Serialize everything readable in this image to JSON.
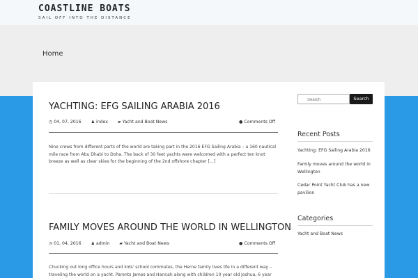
{
  "site": {
    "title": "COASTLINE BOATS",
    "tagline": "SAIL OFF INTO THE DISTANCE"
  },
  "breadcrumb": "Home",
  "posts": [
    {
      "title": "YACHTING: EFG SAILING ARABIA 2016",
      "date": "04, 07, 2016",
      "author": "index",
      "category": "Yacht and Boat News",
      "comments": "Comments Off",
      "excerpt": "Nine crews from different parts of the world are taking part in the 2016 EFG Sailing Arabia – a 160 nautical mile race from Abu Dhabi to Doha. The back of 30 feet yachts were welcomed with a perfect ten knot breeze as well as clear skies for the beginning of the 2nd offshore chapter [...]"
    },
    {
      "title": "FAMILY MOVES AROUND THE WORLD IN WELLINGTON",
      "date": "01, 04, 2016",
      "author": "admin",
      "category": "Yacht and Boat News",
      "comments": "Comments Off",
      "excerpt": "Chucking out long office hours and kids' school commutes, the Herne family lives life in a different way – traveling the world on a yacht. Parents James and Hannah along with children 10 year old Joshua, 6 year old Sadie and 4 year old"
    }
  ],
  "sidebar": {
    "search": {
      "placeholder": "Search",
      "button": "Search"
    },
    "recent_posts": {
      "title": "Recent Posts",
      "items": [
        "Yachting: EFG Sailing Arabia 2016",
        "Family moves around the world in Wellington",
        "Cedar Point Yacht Club has a new pavilion"
      ]
    },
    "categories": {
      "title": "Categories",
      "items": [
        "Yacht and Boat News"
      ]
    }
  },
  "icons": [
    "clock-icon",
    "user-icon",
    "folder-icon",
    "comment-icon",
    "search-icon"
  ],
  "colors": {
    "accent_blue": "#2a9ae7",
    "hero_grey": "#eeeeee",
    "topbar": "#f5f8fb",
    "button_dark": "#1a1a1a"
  }
}
